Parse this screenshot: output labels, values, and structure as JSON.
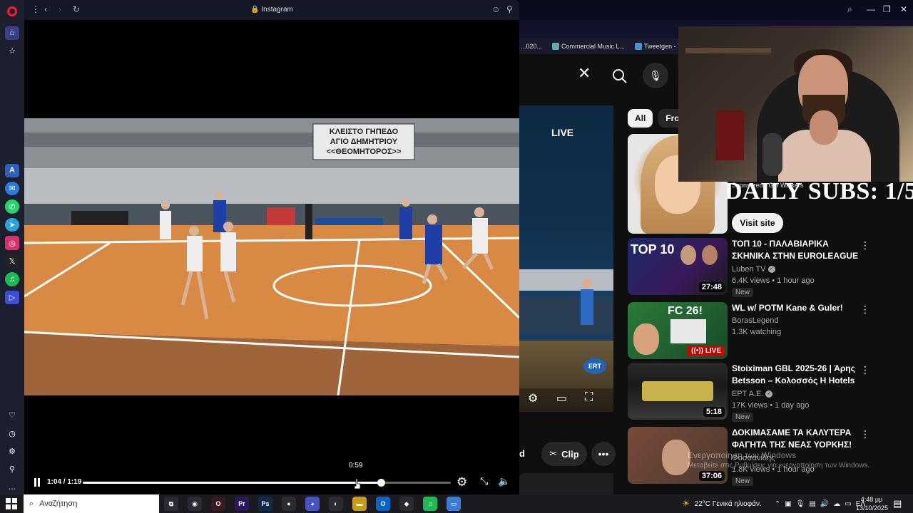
{
  "instagram_window": {
    "title": "Instagram",
    "controls": {
      "current_time": "1:04",
      "total_time": "1:19",
      "time_label": "1:04 / 1:19",
      "progress_fraction": 0.81,
      "hover_time": "0:59"
    },
    "video": {
      "banner_lines": [
        "ΚΛΕΙΣΤΟ ΓΗΠΕΔΟ",
        "ΑΓΙΟ ΔΗΜΗΤΡΙΟΥ",
        "<<ΘΕΟΜΗΤΟΡΟΣ>>"
      ]
    }
  },
  "bookmarks": [
    {
      "label": "...020..."
    },
    {
      "label": "Commercial Music L..."
    },
    {
      "label": "Tweetgen - The Real..."
    }
  ],
  "youtube": {
    "main_video": {
      "live_label": "LIVE",
      "channel_badge": "ERT"
    },
    "actions": {
      "partial_label": "d",
      "clip_label": "Clip"
    },
    "chips": [
      {
        "label": "All",
        "active": true
      },
      {
        "label": "Fron",
        "active": false
      }
    ],
    "ad": {
      "visit_label": "Visit site",
      "advertiser": "Sponsored · Girl Walkers"
    },
    "recommendations": [
      {
        "title": "ΤΟΠ 10 - ΠΑΛΑΒΙΑΡΙΚΑ ΣΚΗΝΙΚΑ ΣΤΗΝ EUROLEAGUE",
        "channel": "Luben TV",
        "verified": true,
        "meta": "6.4K views • 1 hour ago",
        "badge": "New",
        "duration": "27:48",
        "live": false,
        "thumb_text": "TOP 10"
      },
      {
        "title": "WL w/ POTM Kane & Guler!",
        "channel": "BorasLegend",
        "verified": false,
        "meta": "1.3K watching",
        "badge": "",
        "duration": "",
        "live": true,
        "live_label": "LIVE",
        "thumb_text": "FC 26!"
      },
      {
        "title": "Stoiximan GBL 2025-26 | Άρης Betsson – Κολοσσός H Hotels ...",
        "channel": "EPT A.E.",
        "verified": true,
        "meta": "17K views • 1 day ago",
        "badge": "New",
        "duration": "5:18",
        "live": false,
        "thumb_text": ""
      },
      {
        "title": "ΔΟΚΙΜΑΣΑΜΕ ΤΑ ΚΑΛΥΤΕΡΑ ΦΑΓΗΤΑ ΤΗΣ ΝΕΑΣ ΥΟΡΚΗΣ!",
        "channel": "Φοσσανίδης",
        "verified": false,
        "meta": "1.8K views • 1 hour ago",
        "badge": "New",
        "duration": "37:06",
        "live": false,
        "thumb_text": ""
      }
    ]
  },
  "stream_overlay": {
    "daily_subs": "DAILY SUBS: 1/5"
  },
  "watermark": {
    "line1": "Ενεργοποίηση των Windows",
    "line2": "Μεταβείτε στις Ρυθμίσεις για ενεργοποίηση των Windows."
  },
  "taskbar": {
    "search_placeholder": "Αναζήτηση",
    "weather": "22°C  Γενικά ηλιοφάν.",
    "language": "ΕΛ",
    "time": "4:48 μμ",
    "date": "13/10/2025",
    "apps": [
      {
        "name": "task-view",
        "label": "⧉",
        "color": "#2b2b33"
      },
      {
        "name": "chrome",
        "label": "◉",
        "color": "#2b2b33"
      },
      {
        "name": "opera",
        "label": "O",
        "color": "#3a1a22"
      },
      {
        "name": "premiere",
        "label": "Pr",
        "color": "#2a1a5a"
      },
      {
        "name": "photoshop",
        "label": "Ps",
        "color": "#0f2a4a"
      },
      {
        "name": "obs",
        "label": "●",
        "color": "#2b2b33"
      },
      {
        "name": "discord",
        "label": "◕",
        "color": "#4752c4"
      },
      {
        "name": "blender",
        "label": "◐",
        "color": "#2b2b33"
      },
      {
        "name": "explorer",
        "label": "▬",
        "color": "#c99a1a"
      },
      {
        "name": "outlook",
        "label": "O",
        "color": "#0a64c8"
      },
      {
        "name": "app-extra",
        "label": "◆",
        "color": "#2b2b33"
      },
      {
        "name": "spotify",
        "label": "♫",
        "color": "#1db954"
      },
      {
        "name": "app-blue",
        "label": "▭",
        "color": "#3a7bd5"
      }
    ]
  },
  "colors": {
    "youtube_bg": "#0f0f0f",
    "opera_red": "#ff1b2d",
    "live_red": "#cc0000"
  }
}
